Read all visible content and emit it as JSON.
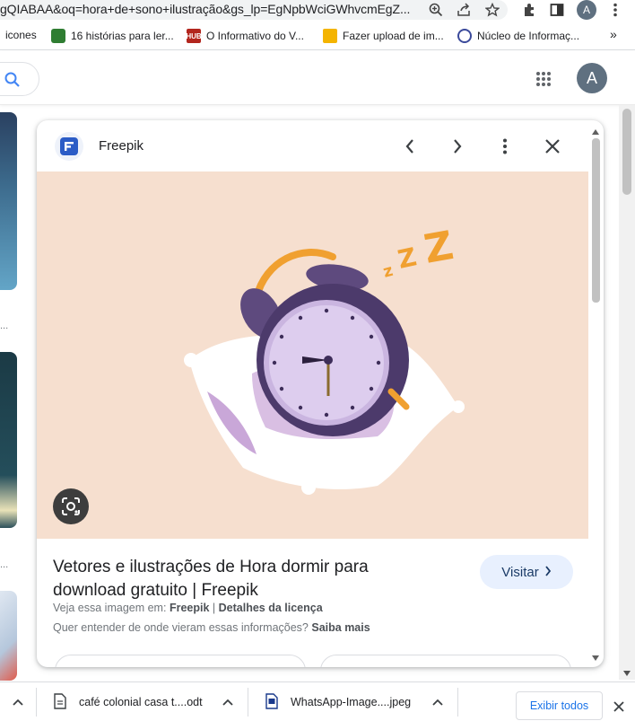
{
  "browser": {
    "url": "gQIABAA&oq=hora+de+sono+ilustração&gs_lp=EgNpbWciGWhvcmEgZ...",
    "profile_initial": "A",
    "icons": [
      "zoom-icon",
      "share-icon",
      "star-icon",
      "extensions-icon",
      "sidepanel-icon",
      "avatar",
      "kebab-menu-icon"
    ]
  },
  "bookmarks": {
    "items": [
      {
        "label": "icones"
      },
      {
        "label": "16 histórias para ler..."
      },
      {
        "label": "O Informativo do V..."
      },
      {
        "label": "Fazer upload de im..."
      },
      {
        "label": "Núcleo de Informaç..."
      }
    ],
    "overflow": "»"
  },
  "google": {
    "avatar_initial": "A"
  },
  "left_strip": {
    "ellipsis_1": "...",
    "ellipsis_2": "..."
  },
  "panel": {
    "source_name": "Freepik",
    "title": "Vetores e ilustrações de Hora dormir para download gratuito | Freepik",
    "visit_label": "Visitar",
    "meta_prefix": "Veja essa imagem em:",
    "meta_source": "Freepik",
    "meta_separator": "|",
    "meta_license": "Detalhes da licença",
    "info_question": "Quer entender de onde vieram essas informações?",
    "info_link": "Saiba mais"
  },
  "downloads": {
    "items": [
      {
        "name": "café colonial casa t....odt"
      },
      {
        "name": "WhatsApp-Image....jpeg"
      }
    ],
    "show_all": "Exibir todos"
  },
  "colors": {
    "image_bg": "#f6dfcf",
    "clock_purple": "#5e4a7e",
    "accent_orange": "#f0a030",
    "link_blue": "#1a73e8"
  }
}
